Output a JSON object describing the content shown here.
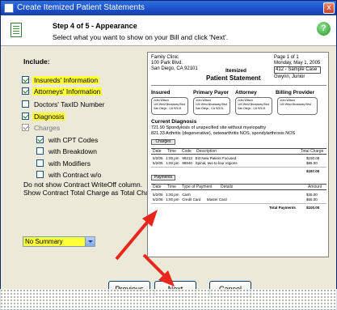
{
  "window": {
    "title": "Create Itemized Patient Statements",
    "close_glyph": "x"
  },
  "header": {
    "step": "Step 4 of 5 - Appearance",
    "description": "Select what you want to show on your Bill and click 'Next'.",
    "help_glyph": "?"
  },
  "include": {
    "label": "Include:",
    "options": [
      {
        "label": "Insureds' Information",
        "checked": true,
        "highlight": true
      },
      {
        "label": "Attorneys' Information",
        "checked": true,
        "highlight": true
      },
      {
        "label": "Doctors' TaxID Number",
        "checked": false,
        "highlight": false
      },
      {
        "label": "Diagnosis",
        "checked": true,
        "highlight": true
      },
      {
        "label": "Charges",
        "checked": true,
        "highlight": false,
        "disabled": true
      },
      {
        "label": "with CPT Codes",
        "checked": true,
        "highlight": false
      },
      {
        "label": "with Breakdown",
        "checked": false,
        "highlight": false
      },
      {
        "label": "with Modifiers",
        "checked": false,
        "highlight": false
      },
      {
        "label": "with Contract w/o",
        "checked": false,
        "highlight": false
      }
    ],
    "note_1": "Do not show Contract WriteOff column.",
    "note_2": "Show Contract Total Charge as Total Charge"
  },
  "summary_select": {
    "value": "No Summary"
  },
  "preview": {
    "clinic_name": "Family Clinic",
    "clinic_addr1": "100 Park Blvd.",
    "clinic_addr2": "San Diego, CA 92101",
    "title_line1": "Itemized",
    "title_line2": "Patient Statement",
    "page": "Page 1 of 1",
    "date": "Monday, May 1, 2005",
    "case": "412 - Sample Case",
    "patient": "Gwynn, Junior",
    "parties": [
      {
        "heading": "Insured",
        "line1": "John Wilson",
        "line2": "100 West Broadway Blvd",
        "line3": "San Diego , CA 92101"
      },
      {
        "heading": "Primary Payor",
        "line1": "John Wilson",
        "line2": "100 West Broadway Blvd",
        "line3": "San Diego , CA 92101"
      },
      {
        "heading": "Attorney",
        "line1": "John Wilson",
        "line2": "100 West Broadway Blvd",
        "line3": "San Diego , CA 92101"
      },
      {
        "heading": "Billing Provider",
        "line1": "John Wilson",
        "line2": "100 West Broadway Blvd",
        "line3": ""
      }
    ],
    "diagnosis_heading": "Current Diagnosis",
    "diag_1": "721.90   Spondylosis of unspecified site without myelopathy",
    "diag_2": "821.33   Arthritis (degenerative), osteoarthritis NOS, spondylarthrosis NOS",
    "charges_tag": "Charges",
    "charges_cols": [
      "Date",
      "Time",
      "Code",
      "Description",
      "Total Charge"
    ],
    "charges_rows": [
      [
        "5/2/05",
        "1:00 pm",
        "99213",
        "Est New Patient Focused",
        "$100.00"
      ],
      [
        "5/2/05",
        "1:00 pm",
        "98940",
        "Spinal, two to four regions",
        "$85.00"
      ]
    ],
    "charges_total": "$187.00",
    "payments_tag": "Payments",
    "payments_cols": [
      "Date",
      "Time",
      "Type of Payment",
      "Details",
      "Amount"
    ],
    "payments_rows": [
      [
        "5/2/05",
        "1:00 pm",
        "Cash",
        "",
        "$35.00"
      ],
      [
        "5/2/05",
        "1:00 pm",
        "Credit Card",
        "Master Card",
        "$65.00"
      ]
    ],
    "payments_total_label": "Total Payments",
    "payments_total": "$100.00"
  },
  "buttons": {
    "previous": "Previous",
    "next": "Next",
    "cancel": "Cancel"
  },
  "colors": {
    "highlight": "#ffff3a",
    "titlebar": "#1b4fc8",
    "arrow": "#e8261c"
  }
}
